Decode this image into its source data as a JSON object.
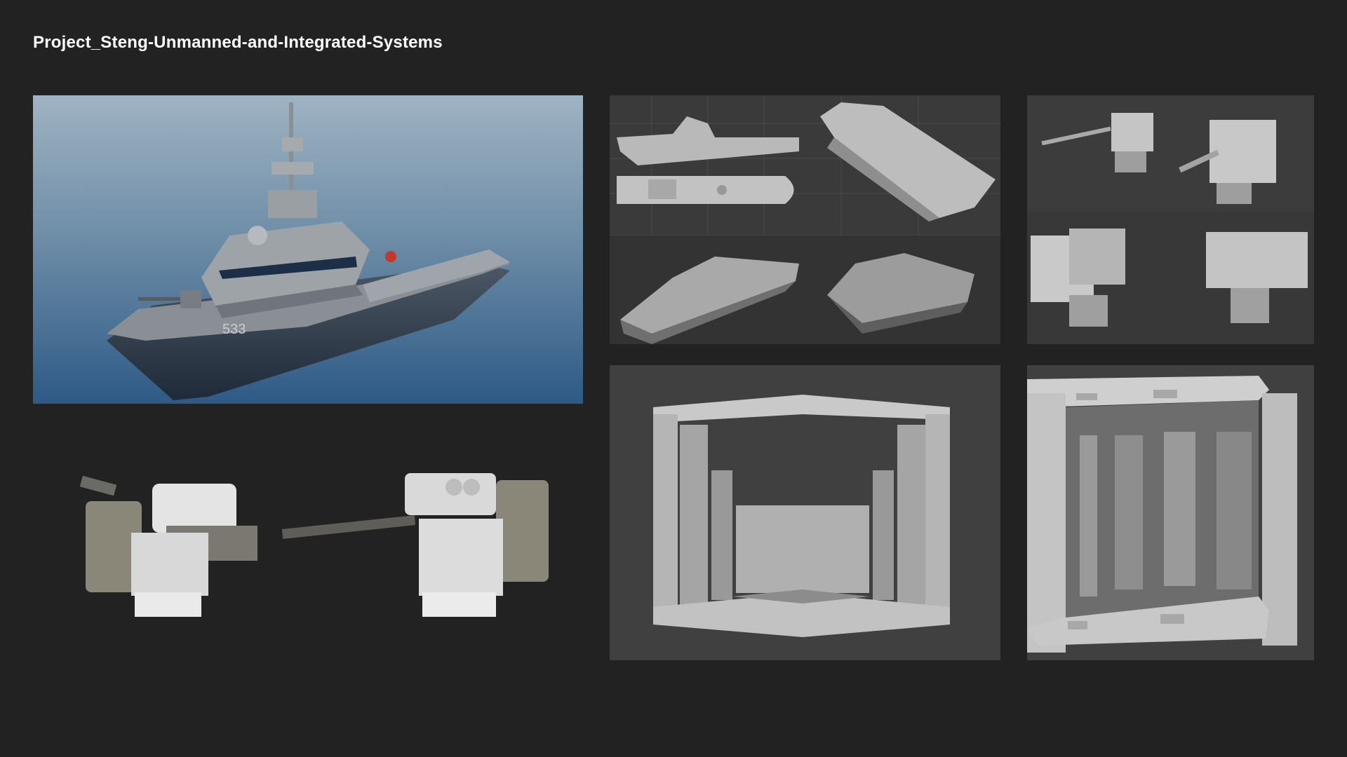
{
  "page": {
    "title": "Project_Steng-Unmanned-and-Integrated-Systems",
    "background": "#222222"
  },
  "panels": {
    "boat_render": {
      "hull_number": "533"
    }
  }
}
